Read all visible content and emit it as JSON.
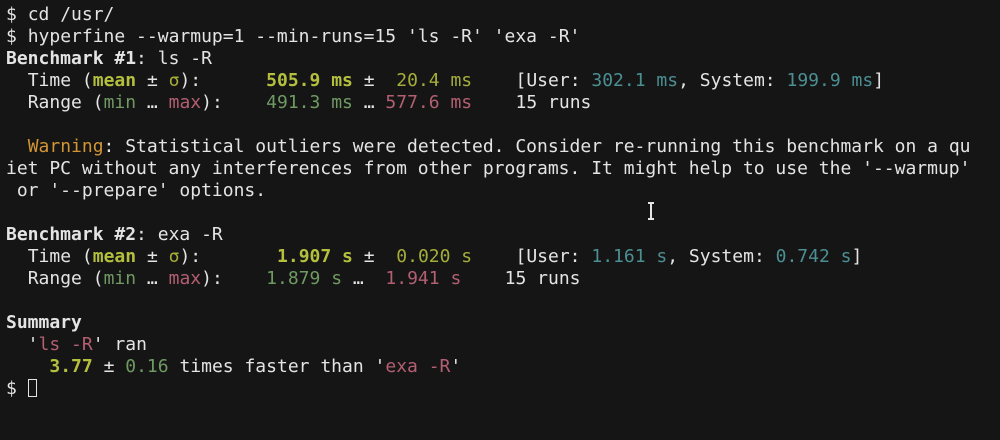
{
  "prompt": "$",
  "commands": {
    "cd": "cd /usr/",
    "hyperfine": "hyperfine --warmup=1 --min-runs=15 'ls -R' 'exa -R'"
  },
  "labels": {
    "time": "Time",
    "mean": "mean",
    "pm": "±",
    "sigma": "σ",
    "range": "Range",
    "min": "min",
    "ellipsis": "…",
    "max": "max",
    "user": "User:",
    "system": "System:",
    "runs_unit": "runs"
  },
  "benchmark1": {
    "header": "Benchmark #1",
    "command": "ls -R",
    "mean_value": "505.9",
    "mean_unit": "ms",
    "sigma_value": "20.4",
    "sigma_unit": "ms",
    "user_value": "302.1",
    "user_unit": "ms",
    "system_value": "199.9",
    "system_unit": "ms",
    "min_value": "491.3",
    "min_unit": "ms",
    "max_value": "577.6",
    "max_unit": "ms",
    "runs": "15"
  },
  "warning": {
    "label": "Warning",
    "line1": ": Statistical outliers were detected. Consider re-running this benchmark on a qu",
    "line2": "iet PC without any interferences from other programs. It might help to use the '--warmup'",
    "line3": " or '--prepare' options."
  },
  "benchmark2": {
    "header": "Benchmark #2",
    "command": "exa -R",
    "mean_value": "1.907",
    "mean_unit": "s",
    "sigma_value": "0.020",
    "sigma_unit": "s",
    "user_value": "1.161",
    "user_unit": "s",
    "system_value": "0.742",
    "system_unit": "s",
    "min_value": "1.879",
    "min_unit": "s",
    "max_value": "1.941",
    "max_unit": "s",
    "runs": "15"
  },
  "summary": {
    "title": "Summary",
    "fastest": "ls -R",
    "ran": "ran",
    "ratio": "3.77",
    "ratio_sigma": "0.16",
    "faster_than": "times faster than",
    "slower": "exa -R"
  },
  "colors": {
    "background": "#151515",
    "foreground": "#e4e4e4",
    "yellow": "#b5bf3e",
    "green": "#6f9a62",
    "magenta": "#b35f72",
    "cyan": "#4c8f93",
    "orange": "#d29532"
  },
  "icons": {
    "cursor": "block-cursor-outline",
    "pointer": "text-ibeam-pointer"
  }
}
